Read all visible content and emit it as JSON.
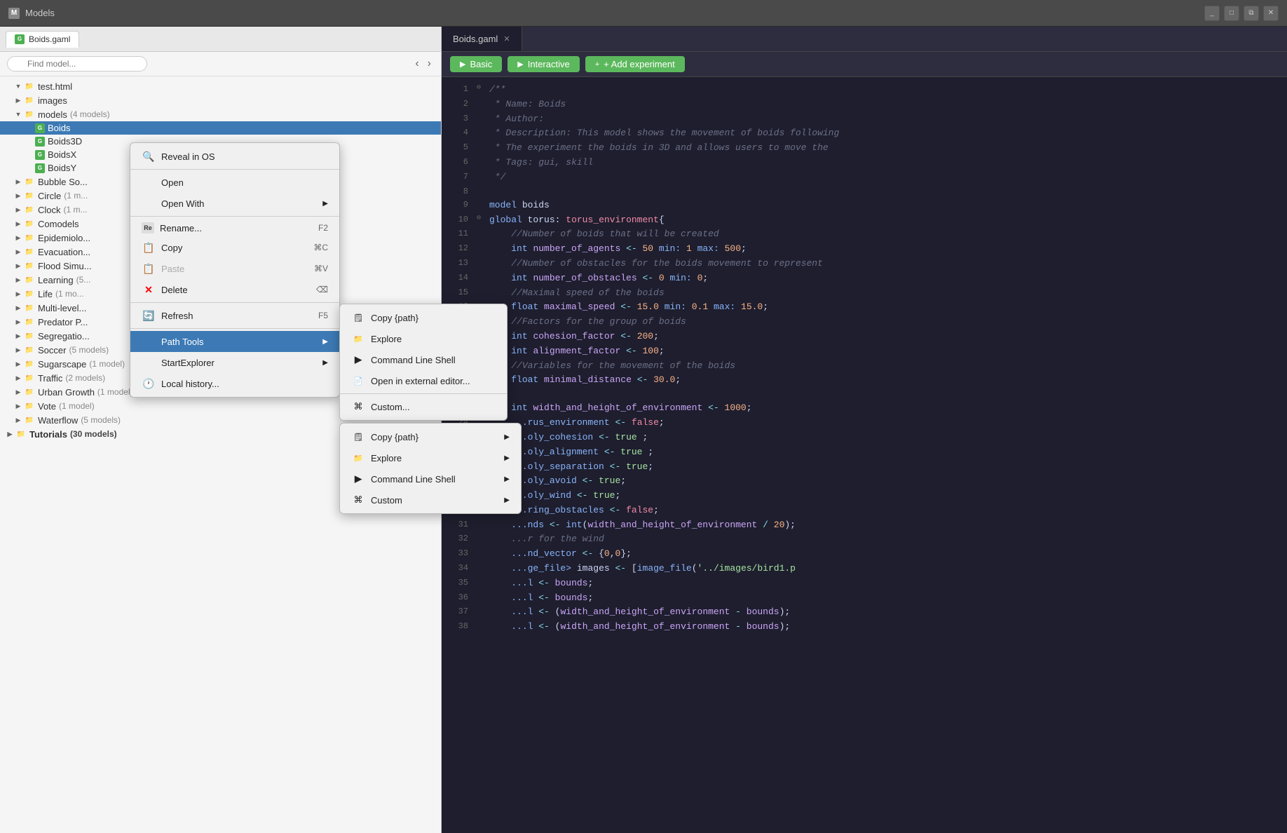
{
  "titleBar": {
    "icon": "M",
    "title": "Models",
    "controls": [
      "minimize",
      "maximize",
      "close"
    ]
  },
  "leftPanel": {
    "tab": {
      "label": "Boids.gaml",
      "icon": "G"
    },
    "search": {
      "placeholder": "Find model...",
      "nav_back": "‹",
      "nav_forward": "›"
    },
    "tree": [
      {
        "level": 1,
        "type": "folder",
        "expand": "open",
        "label": "test.html"
      },
      {
        "level": 1,
        "type": "folder",
        "expand": "closed",
        "label": "images"
      },
      {
        "level": 1,
        "type": "folder",
        "expand": "open",
        "label": "models",
        "count": "(4 models)"
      },
      {
        "level": 2,
        "type": "gfile",
        "expand": "empty",
        "label": "Boids",
        "suffix": "",
        "selected": true
      },
      {
        "level": 2,
        "type": "gfile",
        "expand": "empty",
        "label": "Boids3D",
        "suffix": ""
      },
      {
        "level": 2,
        "type": "gfile",
        "expand": "empty",
        "label": "BoidsX",
        "suffix": ""
      },
      {
        "level": 2,
        "type": "gfile",
        "expand": "empty",
        "label": "BoidsY",
        "suffix": ""
      },
      {
        "level": 1,
        "type": "folder",
        "expand": "closed",
        "label": "Bubble So..."
      },
      {
        "level": 1,
        "type": "folder",
        "expand": "closed",
        "label": "Circle",
        "count": "(1 m..."
      },
      {
        "level": 1,
        "type": "folder",
        "expand": "closed",
        "label": "Clock",
        "count": "(1 m..."
      },
      {
        "level": 1,
        "type": "folder",
        "expand": "closed",
        "label": "Comodels"
      },
      {
        "level": 1,
        "type": "folder",
        "expand": "closed",
        "label": "Epidemiolo..."
      },
      {
        "level": 1,
        "type": "folder",
        "expand": "closed",
        "label": "Evacuation..."
      },
      {
        "level": 1,
        "type": "folder",
        "expand": "closed",
        "label": "Flood Simu..."
      },
      {
        "level": 1,
        "type": "folder",
        "expand": "closed",
        "label": "Learning",
        "count": "(5..."
      },
      {
        "level": 1,
        "type": "folder",
        "expand": "closed",
        "label": "Life",
        "count": "(1 mo..."
      },
      {
        "level": 1,
        "type": "folder",
        "expand": "closed",
        "label": "Multi-level..."
      },
      {
        "level": 1,
        "type": "folder",
        "expand": "closed",
        "label": "Predator P..."
      },
      {
        "level": 1,
        "type": "folder",
        "expand": "closed",
        "label": "Segregatio..."
      },
      {
        "level": 1,
        "type": "folder",
        "expand": "closed",
        "label": "Soccer",
        "count": "(5 models)"
      },
      {
        "level": 1,
        "type": "folder",
        "expand": "closed",
        "label": "Sugarscape",
        "count": "(1 model)"
      },
      {
        "level": 1,
        "type": "folder",
        "expand": "closed",
        "label": "Traffic",
        "count": "(2 models)"
      },
      {
        "level": 1,
        "type": "folder",
        "expand": "closed",
        "label": "Urban Growth",
        "count": "(1 model)"
      },
      {
        "level": 1,
        "type": "folder",
        "expand": "closed",
        "label": "Vote",
        "count": "(1 model)"
      },
      {
        "level": 1,
        "type": "folder",
        "expand": "closed",
        "label": "Waterflow",
        "count": "(5 models)"
      },
      {
        "level": 0,
        "type": "folder",
        "expand": "closed",
        "label": "Tutorials",
        "count": "(30 models)",
        "bold": true
      }
    ]
  },
  "contextMenu": {
    "items": [
      {
        "id": "reveal",
        "icon": "🔍",
        "label": "Reveal in OS",
        "shortcut": ""
      },
      {
        "id": "sep1",
        "type": "separator"
      },
      {
        "id": "open",
        "icon": "",
        "label": "Open",
        "shortcut": ""
      },
      {
        "id": "openwith",
        "icon": "",
        "label": "Open With",
        "shortcut": "",
        "arrow": true
      },
      {
        "id": "sep2",
        "type": "separator"
      },
      {
        "id": "rename",
        "icon": "Re",
        "label": "Rename...",
        "shortcut": "F2"
      },
      {
        "id": "copy",
        "icon": "📋",
        "label": "Copy",
        "shortcut": "⌘C"
      },
      {
        "id": "paste",
        "icon": "📋",
        "label": "Paste",
        "shortcut": "⌘V",
        "disabled": true
      },
      {
        "id": "delete",
        "icon": "✕",
        "label": "Delete",
        "shortcut": "⌫"
      },
      {
        "id": "sep3",
        "type": "separator"
      },
      {
        "id": "refresh",
        "icon": "🔄",
        "label": "Refresh",
        "shortcut": "F5"
      },
      {
        "id": "sep4",
        "type": "separator"
      },
      {
        "id": "pathtools",
        "icon": "",
        "label": "Path Tools",
        "shortcut": "",
        "arrow": true,
        "highlighted": true
      },
      {
        "id": "startexplorer",
        "icon": "",
        "label": "StartExplorer",
        "shortcut": "",
        "arrow": true
      },
      {
        "id": "localhistory",
        "icon": "🕐",
        "label": "Local history...",
        "shortcut": ""
      }
    ]
  },
  "subMenu1": {
    "items": [
      {
        "id": "copy_path",
        "icon": "📋",
        "label": "Copy {path}",
        "shortcut": ""
      },
      {
        "id": "explore",
        "icon": "📁",
        "label": "Explore",
        "shortcut": ""
      },
      {
        "id": "cmdline",
        "icon": "▶",
        "label": "Command Line Shell",
        "shortcut": ""
      },
      {
        "id": "openext",
        "icon": "📄",
        "label": "Open in external editor...",
        "shortcut": ""
      },
      {
        "id": "custom",
        "icon": "⌘",
        "label": "Custom...",
        "shortcut": ""
      }
    ]
  },
  "subMenu2": {
    "items": [
      {
        "id": "copy_path2",
        "icon": "📋",
        "label": "Copy {path}",
        "arrow": true
      },
      {
        "id": "explore2",
        "icon": "📁",
        "label": "Explore",
        "arrow": true
      },
      {
        "id": "cmdline2",
        "icon": "▶",
        "label": "Command Line Shell",
        "arrow": true
      },
      {
        "id": "custom2",
        "icon": "⌘",
        "label": "Custom",
        "arrow": true
      }
    ]
  },
  "editor": {
    "tab": "Boids.gaml",
    "tabClose": "✕",
    "buttons": {
      "basic": "Basic",
      "interactive": "Interactive",
      "add": "+ Add experiment"
    },
    "lines": [
      {
        "num": "1",
        "fold": "⊖",
        "content": "/**"
      },
      {
        "num": "2",
        "fold": " ",
        "content": " * Name: Boids"
      },
      {
        "num": "3",
        "fold": " ",
        "content": " * Author:"
      },
      {
        "num": "4",
        "fold": " ",
        "content": " * Description: This model shows the movement of boids following"
      },
      {
        "num": "5",
        "fold": " ",
        "content": " * The experiment the boids in 3D and allows users to move the"
      },
      {
        "num": "6",
        "fold": " ",
        "content": " * Tags: gui, skill"
      },
      {
        "num": "7",
        "fold": " ",
        "content": " */"
      },
      {
        "num": "8",
        "fold": " ",
        "content": ""
      },
      {
        "num": "9",
        "fold": " ",
        "content": "model boids"
      },
      {
        "num": "10",
        "fold": "⊖",
        "content": "global torus: torus_environment{"
      },
      {
        "num": "11",
        "fold": " ",
        "content": "    //Number of boids that will be created"
      },
      {
        "num": "12",
        "fold": " ",
        "content": "    int number_of_agents <- 50 min: 1 max: 500;"
      },
      {
        "num": "13",
        "fold": " ",
        "content": "    //Number of obstacles for the boids movement to represent"
      },
      {
        "num": "14",
        "fold": " ",
        "content": "    int number_of_obstacles <- 0 min: 0;"
      },
      {
        "num": "15",
        "fold": " ",
        "content": "    //Maximal speed of the boids"
      },
      {
        "num": "16",
        "fold": " ",
        "content": "    float maximal_speed <- 15.0 min: 0.1 max: 15.0;"
      },
      {
        "num": "17",
        "fold": " ",
        "content": "    //Factors for the group of boids"
      },
      {
        "num": "18",
        "fold": " ",
        "content": "    int cohesion_factor <- 200;"
      },
      {
        "num": "19",
        "fold": " ",
        "content": "    int alignment_factor <- 100;"
      },
      {
        "num": "20",
        "fold": " ",
        "content": "    //Variables for the movement of the boids"
      },
      {
        "num": "21",
        "fold": " ",
        "content": "    float minimal_distance <- 30.0;"
      },
      {
        "num": "22",
        "fold": " ",
        "content": ""
      },
      {
        "num": "23",
        "fold": " ",
        "content": "    int width_and_height_of_environment <- 1000;"
      },
      {
        "num": "24",
        "fold": " ",
        "content": "    ...rus_environment <- false;"
      },
      {
        "num": "25",
        "fold": " ",
        "content": "    ...oly_cohesion <- true ;"
      },
      {
        "num": "26",
        "fold": " ",
        "content": "    ...oly_alignment <- true ;"
      },
      {
        "num": "27",
        "fold": " ",
        "content": "    ...oly_separation <- true;"
      },
      {
        "num": "28",
        "fold": " ",
        "content": "    ...oly_avoid <- true;"
      },
      {
        "num": "29",
        "fold": " ",
        "content": "    ...oly_wind <- true;"
      },
      {
        "num": "30",
        "fold": " ",
        "content": "    ...ring_obstacles <- false;"
      },
      {
        "num": "31",
        "fold": " ",
        "content": "    ...nds <- int(width_and_height_of_environment / 20);"
      },
      {
        "num": "32",
        "fold": " ",
        "content": "    ...r for the wind"
      },
      {
        "num": "33",
        "fold": " ",
        "content": "    ...nd_vector <- {0,0};"
      },
      {
        "num": "34",
        "fold": " ",
        "content": "    ...ge_file> images <- [image_file('../images/bird1.p"
      },
      {
        "num": "35",
        "fold": " ",
        "content": "    ...l <- bounds;"
      },
      {
        "num": "36",
        "fold": " ",
        "content": "    ...l <- bounds;"
      },
      {
        "num": "37",
        "fold": " ",
        "content": "    ...l <- (width_and_height_of_environment - bounds);"
      },
      {
        "num": "38",
        "fold": " ",
        "content": "    ...l <- (width_and_height_of_environment - bounds);"
      }
    ]
  },
  "bottomHint": {
    "cmdline": "Command Line Shell",
    "custom": "8 Custom"
  }
}
